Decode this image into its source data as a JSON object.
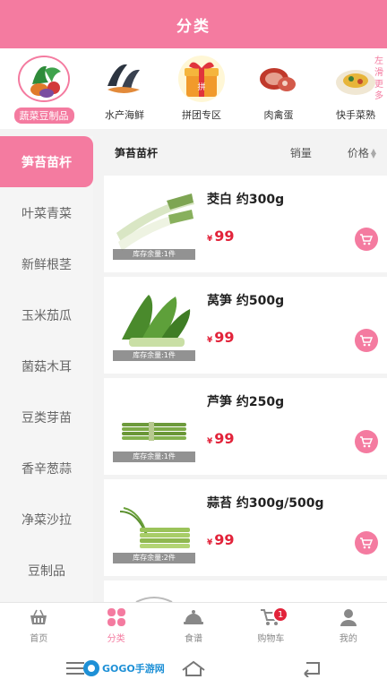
{
  "header": {
    "title": "分类"
  },
  "categories": [
    {
      "label": "蔬菜豆制品",
      "icon": "vegetables-icon",
      "active": true
    },
    {
      "label": "水产海鲜",
      "icon": "seafood-icon",
      "active": false
    },
    {
      "label": "拼团专区",
      "icon": "gift-box-icon",
      "active": false
    },
    {
      "label": "肉禽蛋",
      "icon": "meat-icon",
      "active": false
    },
    {
      "label": "快手菜熟",
      "icon": "dish-icon",
      "active": false
    }
  ],
  "swipe_hint": "左滑更多",
  "sidebar": {
    "items": [
      {
        "label": "笋苔苗杆",
        "active": true
      },
      {
        "label": "叶菜青菜"
      },
      {
        "label": "新鲜根茎"
      },
      {
        "label": "玉米茄瓜"
      },
      {
        "label": "菌菇木耳"
      },
      {
        "label": "豆类芽苗"
      },
      {
        "label": "香辛葱蒜"
      },
      {
        "label": "净菜沙拉"
      },
      {
        "label": "豆制品"
      }
    ]
  },
  "content": {
    "title": "笋苔苗杆",
    "sort_sales": "销量",
    "sort_price": "价格"
  },
  "products": [
    {
      "name": "茭白 约300g",
      "currency": "¥",
      "price": "99",
      "stock": "库存余量:1件",
      "image": "water-bamboo"
    },
    {
      "name": "莴笋 约500g",
      "currency": "¥",
      "price": "99",
      "stock": "库存余量:1件",
      "image": "lettuce-stem"
    },
    {
      "name": "芦笋 约250g",
      "currency": "¥",
      "price": "99",
      "stock": "库存余量:1件",
      "image": "asparagus"
    },
    {
      "name": "蒜苔 约300g/500g",
      "currency": "¥",
      "price": "99",
      "stock": "库存余量:2件",
      "image": "garlic-sprout"
    }
  ],
  "tabbar": {
    "tabs": [
      {
        "label": "首页",
        "icon": "basket-icon"
      },
      {
        "label": "分类",
        "icon": "category-grid-icon",
        "active": true
      },
      {
        "label": "食谱",
        "icon": "cloche-icon"
      },
      {
        "label": "购物车",
        "icon": "cart-icon",
        "badge": "1"
      },
      {
        "label": "我的",
        "icon": "user-icon"
      }
    ]
  },
  "watermark": "GOGO手游网",
  "colors": {
    "accent": "#f47ba0",
    "price": "#e2233a"
  }
}
